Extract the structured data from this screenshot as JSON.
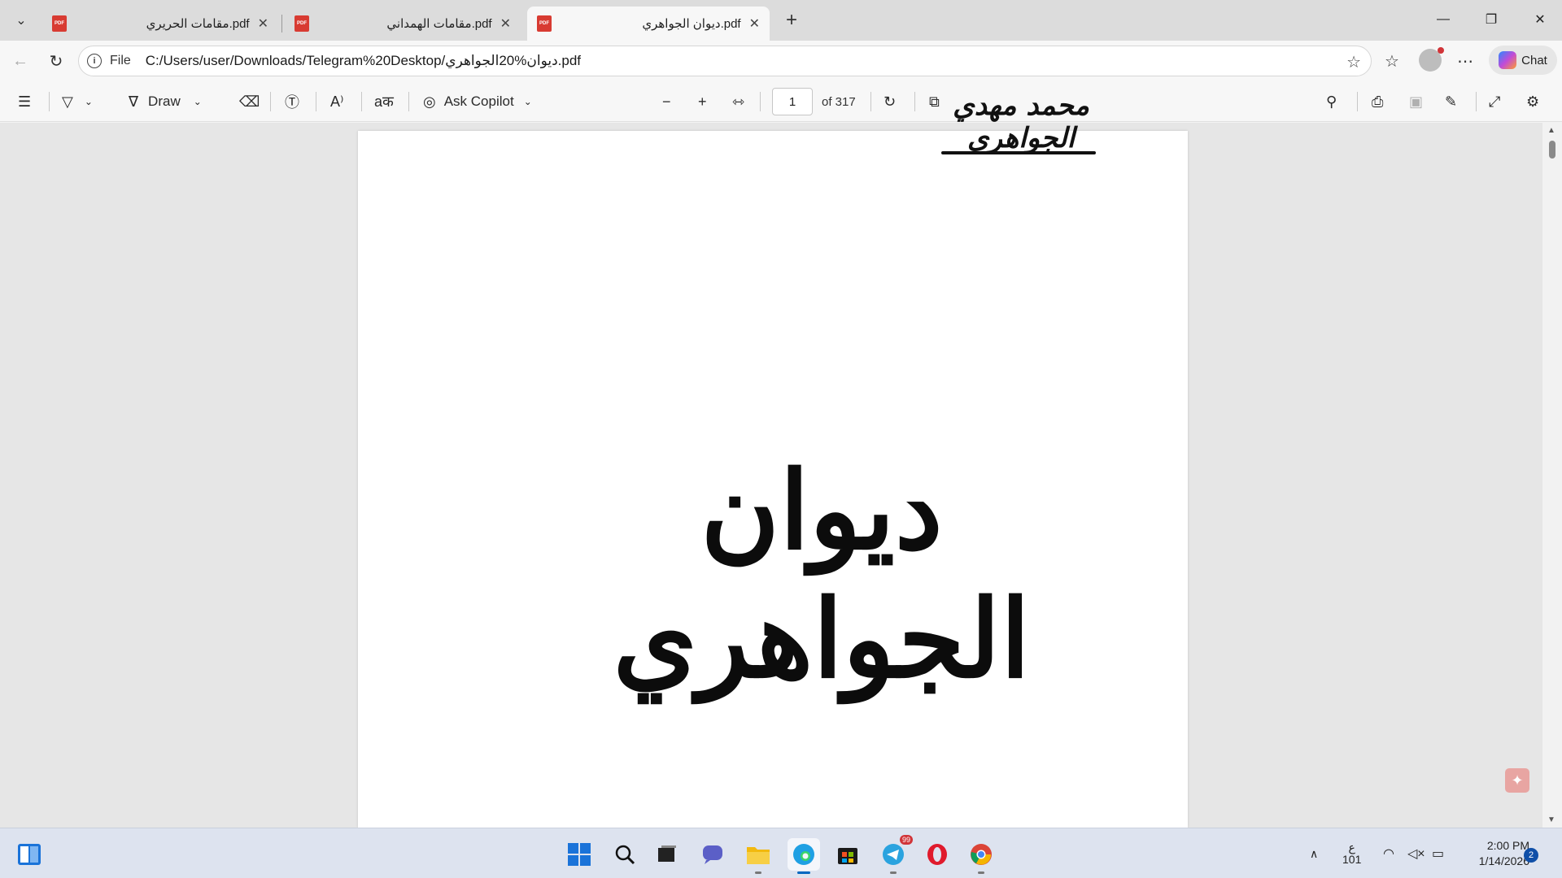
{
  "browser": {
    "tabs": [
      {
        "title": "مقامات الحريري.pdf",
        "active": false
      },
      {
        "title": "مقامات الهمداني.pdf",
        "active": false
      },
      {
        "title": "ديوان الجواهري.pdf",
        "active": true
      }
    ],
    "pdf_icon_text": "PDF",
    "new_tab_icon": "+",
    "address": {
      "scheme": "File",
      "url": "C:/Users/user/Downloads/Telegram%20Desktop/ديوان%20الجواهري.pdf"
    },
    "chat_label": "Chat"
  },
  "pdf_toolbar": {
    "draw_label": "Draw",
    "ask_copilot_label": "Ask Copilot",
    "current_page": "1",
    "page_total_label": "of 317"
  },
  "document": {
    "author_signature": "محمد مهدي الجواهري",
    "title_calligraphy": "ديوان الجواهري"
  },
  "taskbar": {
    "apps": [
      {
        "name": "search"
      },
      {
        "name": "task-view"
      },
      {
        "name": "teams"
      },
      {
        "name": "file-explorer"
      },
      {
        "name": "edge",
        "active": true
      },
      {
        "name": "store"
      },
      {
        "name": "telegram",
        "badge": "99"
      },
      {
        "name": "opera"
      },
      {
        "name": "chrome"
      }
    ],
    "input_lang": "ع",
    "input_lang_sub": "101",
    "time": "2:00 PM",
    "date": "1/14/2026",
    "notification_count": "2"
  },
  "colors": {
    "accent": "#0067c0",
    "pdf_red": "#d83b32"
  }
}
